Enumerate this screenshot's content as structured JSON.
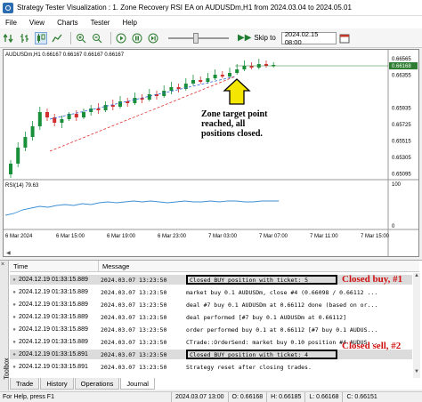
{
  "window": {
    "title": "Strategy Tester Visualization : 1. Zone Recovery RSI EA on AUDUSDm,H1 from 2024.03.04 to 2024.05.01"
  },
  "menu": [
    "File",
    "View",
    "Charts",
    "Tester",
    "Help"
  ],
  "toolbar": {
    "skip_label": "Skip to",
    "skip_date": "2024.02.15 08:00",
    "icons": [
      "green-arrows-icon",
      "bar-chart-icon",
      "candlestick-icon",
      "line-chart-icon",
      "zoom-in-icon",
      "zoom-out-icon",
      "play-icon",
      "pause-icon",
      "step-icon"
    ]
  },
  "chart": {
    "header": "AUDUSDm,H1  0.66167  0.66167  0.66167  0.66167",
    "price_labels": [
      "0.66565",
      "0.66355",
      "0.66168",
      "0.65935",
      "0.65725",
      "0.65515",
      "0.65305",
      "0.65095"
    ],
    "current_price": "0.66168",
    "annotation": [
      "Zone target point",
      "reached, all",
      "positions closed."
    ],
    "rsi_label": "RSI(14) 79.63",
    "rsi_scale": [
      "100",
      "0"
    ],
    "time_labels": [
      "6 Mar 2024",
      "6 Mar 15:00",
      "6 Mar 19:00",
      "6 Mar 23:00",
      "7 Mar 03:00",
      "7 Mar 07:00",
      "7 Mar 11:00",
      "7 Mar 15:00"
    ]
  },
  "journal": {
    "columns": [
      "Time",
      "Message"
    ],
    "rows": [
      {
        "time": "2024.12.19 01:33:15.889",
        "time2": "2024.03.07 13:23:50",
        "message": "Closed BUY position with ticket: 5",
        "boxed": true
      },
      {
        "time": "2024.12.19 01:33:15.889",
        "time2": "2024.03.07 13:23:50",
        "message": "market buy 0.1 AUDUSDm, close #4 (0.66098 / 0.66112 ...",
        "boxed": false
      },
      {
        "time": "2024.12.19 01:33:15.889",
        "time2": "2024.03.07 13:23:50",
        "message": "deal #7 buy 0.1 AUDUSDm at 0.66112 done (based on or...",
        "boxed": false
      },
      {
        "time": "2024.12.19 01:33:15.889",
        "time2": "2024.03.07 13:23:50",
        "message": "deal performed [#7 buy 0.1 AUDUSDm at 0.66112]",
        "boxed": false
      },
      {
        "time": "2024.12.19 01:33:15.889",
        "time2": "2024.03.07 13:23:50",
        "message": "order performed buy 0.1 at 0.66112 [#7 buy 0.1 AUDUS...",
        "boxed": false
      },
      {
        "time": "2024.12.19 01:33:15.889",
        "time2": "2024.03.07 13:23:50",
        "message": "CTrade::OrderSend: market buy 0.10 position #4 AUDUS...",
        "boxed": false
      },
      {
        "time": "2024.12.19 01:33:15.891",
        "time2": "2024.03.07 13:23:50",
        "message": "Closed BUY position with ticket: 4",
        "boxed": true
      },
      {
        "time": "2024.12.19 01:33:15.891",
        "time2": "2024.03.07 13:23:50",
        "message": "Strategy reset after closing trades.",
        "boxed": false
      }
    ],
    "annotations": [
      "Closed buy, #1",
      "Closed sell, #2"
    ],
    "tabs": [
      "Trade",
      "History",
      "Operations",
      "Journal"
    ],
    "active_tab": "Journal",
    "toolbox_label": "Toolbox"
  },
  "status": {
    "help": "For Help, press F1",
    "date": "2024.03.07 13:00",
    "open": "O: 0.66168",
    "high": "H: 0.66185",
    "low": "L: 0.66168",
    "close": "C: 0.66151"
  },
  "colors": {
    "bull_candle": "#1a8f3a",
    "bear_candle": "#d32f2f",
    "sell_line": "#2b5fd9",
    "buy_line": "#e03030",
    "rsi_line": "#3b8fd6",
    "arrow_fill": "#f4e600"
  }
}
